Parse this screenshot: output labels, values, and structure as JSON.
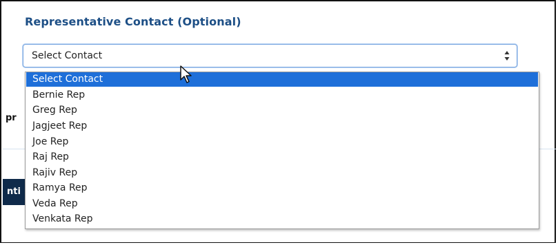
{
  "section": {
    "title": "Representative Contact (Optional)"
  },
  "select": {
    "value": "Select Contact",
    "options": [
      "Select Contact",
      "Bernie Rep",
      "Greg Rep",
      "Jagjeet Rep",
      "Joe Rep",
      "Raj Rep",
      "Rajiv Rep",
      "Ramya Rep",
      "Veda Rep",
      "Venkata Rep"
    ],
    "selected_index": 0
  },
  "background": {
    "partial_label": "pr",
    "partial_button": "nti"
  },
  "colors": {
    "title": "#1d4f86",
    "selected_bg": "#1e6fd9",
    "dark_button": "#0f2a4a"
  },
  "icons": {
    "select_arrows": "up-down-arrows-icon",
    "cursor": "mouse-pointer-icon"
  }
}
